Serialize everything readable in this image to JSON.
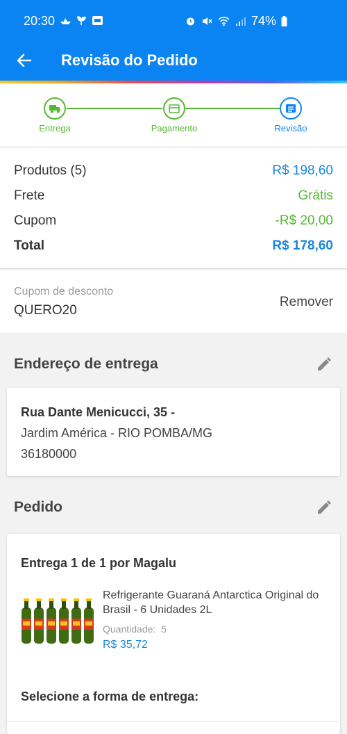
{
  "status_bar": {
    "time": "20:30",
    "battery": "74%",
    "left_icons": [
      "boat-icon",
      "plant-icon",
      "app-icon"
    ],
    "right_icons": [
      "alarm-icon",
      "mute-icon",
      "wifi-icon",
      "signal-icon",
      "battery-icon"
    ]
  },
  "header": {
    "title": "Revisão do Pedido",
    "color": "#0a84f3"
  },
  "stepper": {
    "steps": [
      {
        "label": "Entrega",
        "icon": "truck-icon",
        "state": "done"
      },
      {
        "label": "Pagamento",
        "icon": "card-icon",
        "state": "done"
      },
      {
        "label": "Revisão",
        "icon": "list-icon",
        "state": "active"
      }
    ],
    "done_color": "#55b833",
    "active_color": "#0a84f3"
  },
  "summary": {
    "rows": [
      {
        "label": "Produtos (5)",
        "value": "R$ 198,60"
      },
      {
        "label": "Frete",
        "value": "Grátis"
      },
      {
        "label": "Cupom",
        "value": "-R$ 20,00"
      },
      {
        "label": "Total",
        "value": "R$ 178,60"
      }
    ]
  },
  "coupon": {
    "label": "Cupom de desconto",
    "code": "QUERO20",
    "remove_label": "Remover"
  },
  "address_section": {
    "title": "Endereço de entrega",
    "line1": "Rua Dante Menicucci, 35 -",
    "line2": "Jardim América - RIO POMBA/MG",
    "line3": "36180000"
  },
  "order_section": {
    "title": "Pedido",
    "delivery_title": "Entrega 1 de 1 por Magalu",
    "product": {
      "name": "Refrigerante Guaraná Antarctica Original do Brasil - 6 Unidades 2L",
      "quantity_label": "Quantidade:",
      "quantity": "5",
      "price": "R$ 35,72"
    },
    "choose_delivery": "Selecione a forma de entrega:"
  }
}
